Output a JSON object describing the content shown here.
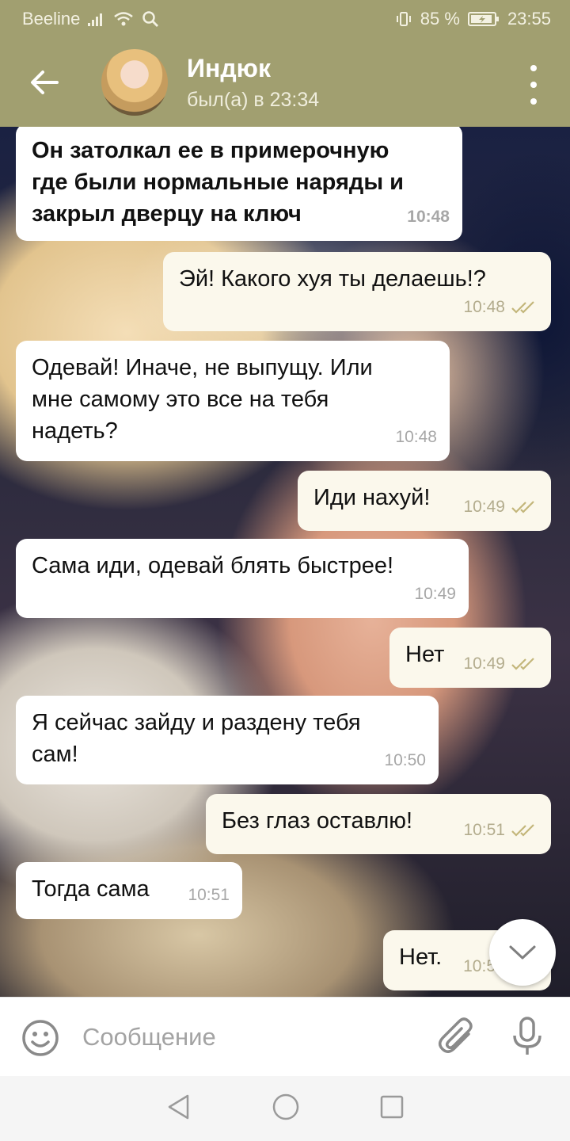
{
  "status_bar": {
    "carrier": "Beeline",
    "battery": "85 %",
    "time": "23:55"
  },
  "header": {
    "title": "Индюк",
    "subtitle": "был(а) в 23:34"
  },
  "messages": [
    {
      "direction": "in",
      "text": "Он затолкал ее в примерочную\nгде были нормальные наряды и\nзакрыл дверцу на ключ",
      "time": "10:48"
    },
    {
      "direction": "out",
      "text": "Эй! Какого хуя ты делаешь!?",
      "time": "10:48"
    },
    {
      "direction": "in",
      "text": "Одевай! Иначе, не выпущу. Или\nмне самому это все на тебя\nнадеть?",
      "time": "10:48"
    },
    {
      "direction": "out",
      "text": "Иди нахуй!",
      "time": "10:49"
    },
    {
      "direction": "in",
      "text": "Сама иди, одевай блять быстрее!",
      "time": "10:49"
    },
    {
      "direction": "out",
      "text": "Нет",
      "time": "10:49"
    },
    {
      "direction": "in",
      "text": "Я сейчас зайду и раздену тебя\nсам!",
      "time": "10:50"
    },
    {
      "direction": "out",
      "text": "Без глаз оставлю!",
      "time": "10:51"
    },
    {
      "direction": "in",
      "text": "Тогда сама",
      "time": "10:51"
    },
    {
      "direction": "out",
      "text": "Нет.",
      "time": "10:5"
    }
  ],
  "composer": {
    "placeholder": "Сообщение"
  },
  "colors": {
    "header": "#a19f70",
    "incoming_bubble": "#ffffff",
    "outgoing_bubble": "#fbf8ec",
    "read_check": "#c3b67a"
  },
  "icons": [
    "back-arrow-icon",
    "more-vert-icon",
    "double-check-icon",
    "chevron-down-icon",
    "emoji-icon",
    "paperclip-icon",
    "microphone-icon",
    "nav-back-icon",
    "nav-home-icon",
    "nav-recents-icon"
  ]
}
